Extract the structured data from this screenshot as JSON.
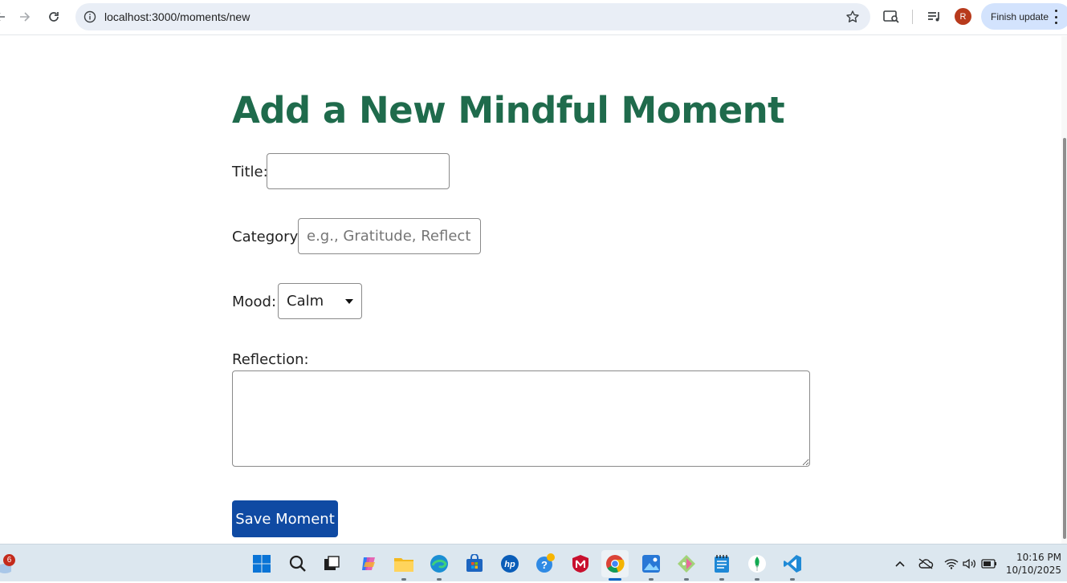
{
  "browser": {
    "url": "localhost:3000/moments/new",
    "profile_initial": "R",
    "finish_update_label": "Finish update"
  },
  "page": {
    "title": "Add a New Mindful Moment",
    "fields": {
      "title_label": "Title:",
      "title_value": "",
      "category_label": "Category:",
      "category_placeholder": "e.g., Gratitude, Reflection",
      "mood_label": "Mood:",
      "mood_selected": "Calm",
      "reflection_label": "Reflection:",
      "reflection_value": ""
    },
    "save_button_label": "Save Moment"
  },
  "taskbar": {
    "weather_badge": "6",
    "apps": [
      "start-icon",
      "search-icon",
      "task-view-icon",
      "copilot-icon",
      "file-explorer-icon",
      "edge-icon",
      "store-icon",
      "hp-icon",
      "help-icon",
      "mcafee-icon",
      "chrome-icon",
      "photos-icon",
      "git-icon",
      "notepad-icon",
      "mongodb-icon",
      "vscode-icon"
    ],
    "clock_time": "10:16 PM",
    "clock_date": "10/10/2025"
  },
  "colors": {
    "title_green": "#1f6b4c",
    "save_button_blue": "#0f4aa3",
    "omnibox_bg": "#e9eef6",
    "finish_update_bg": "#d3e3fd"
  }
}
